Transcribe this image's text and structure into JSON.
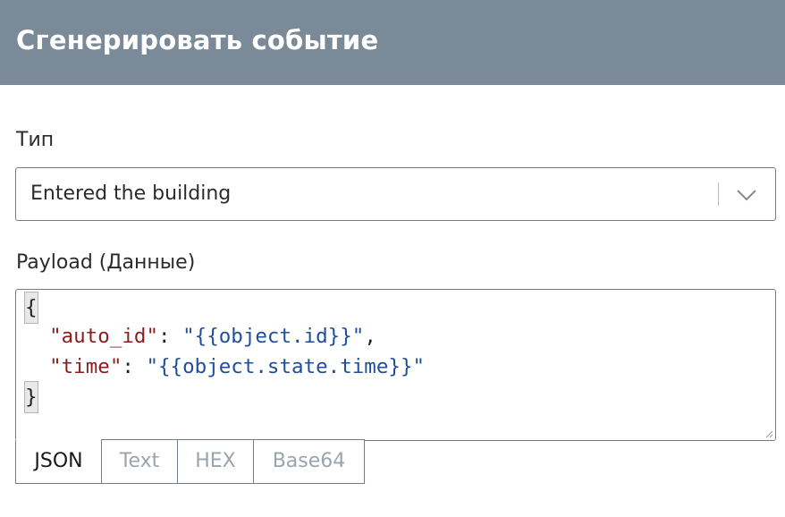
{
  "header": {
    "title": "Сгенерировать событие"
  },
  "type_field": {
    "label": "Тип",
    "selected": "Entered the building"
  },
  "payload_field": {
    "label": "Payload (Данные)",
    "code": {
      "open_brace": "{",
      "close_brace": "}",
      "lines": [
        {
          "key": "\"auto_id\"",
          "sep": ": ",
          "value": "\"{{object.id}}\"",
          "trail": ","
        },
        {
          "key": "\"time\"",
          "sep": ": ",
          "value": "\"{{object.state.time}}\"",
          "trail": ""
        }
      ]
    }
  },
  "format_tabs": [
    {
      "label": "JSON",
      "active": true
    },
    {
      "label": "Text",
      "active": false
    },
    {
      "label": "HEX",
      "active": false
    },
    {
      "label": "Base64",
      "active": false
    }
  ],
  "colors": {
    "header_bg": "#7a8a99",
    "border": "#6f7f8c",
    "json_key": "#8b1d1d",
    "json_string": "#1f4e9a"
  }
}
